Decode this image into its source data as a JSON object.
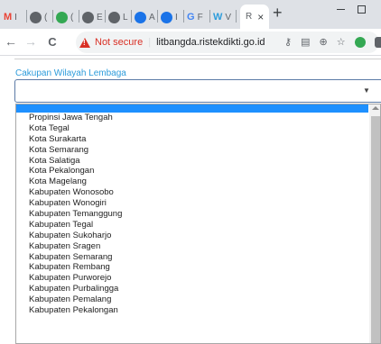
{
  "tabs": [
    {
      "icon": "gmail-icon",
      "color": "#ea4335",
      "text": "M",
      "after": "I"
    },
    {
      "icon": "ball-icon",
      "color": "#5f6368",
      "text": "",
      "after": "("
    },
    {
      "icon": "green-circle-icon",
      "color": "#34a853",
      "text": "",
      "after": "("
    },
    {
      "icon": "ball-icon",
      "color": "#5f6368",
      "text": "",
      "after": "E"
    },
    {
      "icon": "ball-icon",
      "color": "#5f6368",
      "text": "",
      "after": "L"
    },
    {
      "icon": "blue-circle-icon",
      "color": "#1a73e8",
      "text": "",
      "after": "A"
    },
    {
      "icon": "blue-circle-icon",
      "color": "#1a73e8",
      "text": "",
      "after": "I"
    },
    {
      "icon": "google-icon",
      "color": "#4285f4",
      "text": "G",
      "after": "F"
    },
    {
      "icon": "w-icon",
      "color": "#2d9cdb",
      "text": "W",
      "after": "V"
    }
  ],
  "active_tab": {
    "text": "R",
    "close": "×"
  },
  "new_tab": "+",
  "nav": {
    "back": "←",
    "forward": "→",
    "reload": "C"
  },
  "address_bar": {
    "security": "Not secure",
    "separator": "|",
    "url": "litbangda.ristekdikti.go.id"
  },
  "field": {
    "label": "Cakupan Wilayah Lembaga",
    "value": "",
    "arrow": "▼"
  },
  "dropdown_options": [
    "Propinsi Jawa Tengah",
    "Kota Tegal",
    "Kota Surakarta",
    "Kota Semarang",
    "Kota Salatiga",
    "Kota Pekalongan",
    "Kota Magelang",
    "Kabupaten Wonosobo",
    "Kabupaten Wonogiri",
    "Kabupaten Temanggung",
    "Kabupaten Tegal",
    "Kabupaten Sukoharjo",
    "Kabupaten Sragen",
    "Kabupaten Semarang",
    "Kabupaten Rembang",
    "Kabupaten Purworejo",
    "Kabupaten Purbalingga",
    "Kabupaten Pemalang",
    "Kabupaten Pekalongan"
  ],
  "colors": {
    "highlight": "#1e90ff",
    "label": "#2d9cdb",
    "warning": "#d93025"
  }
}
